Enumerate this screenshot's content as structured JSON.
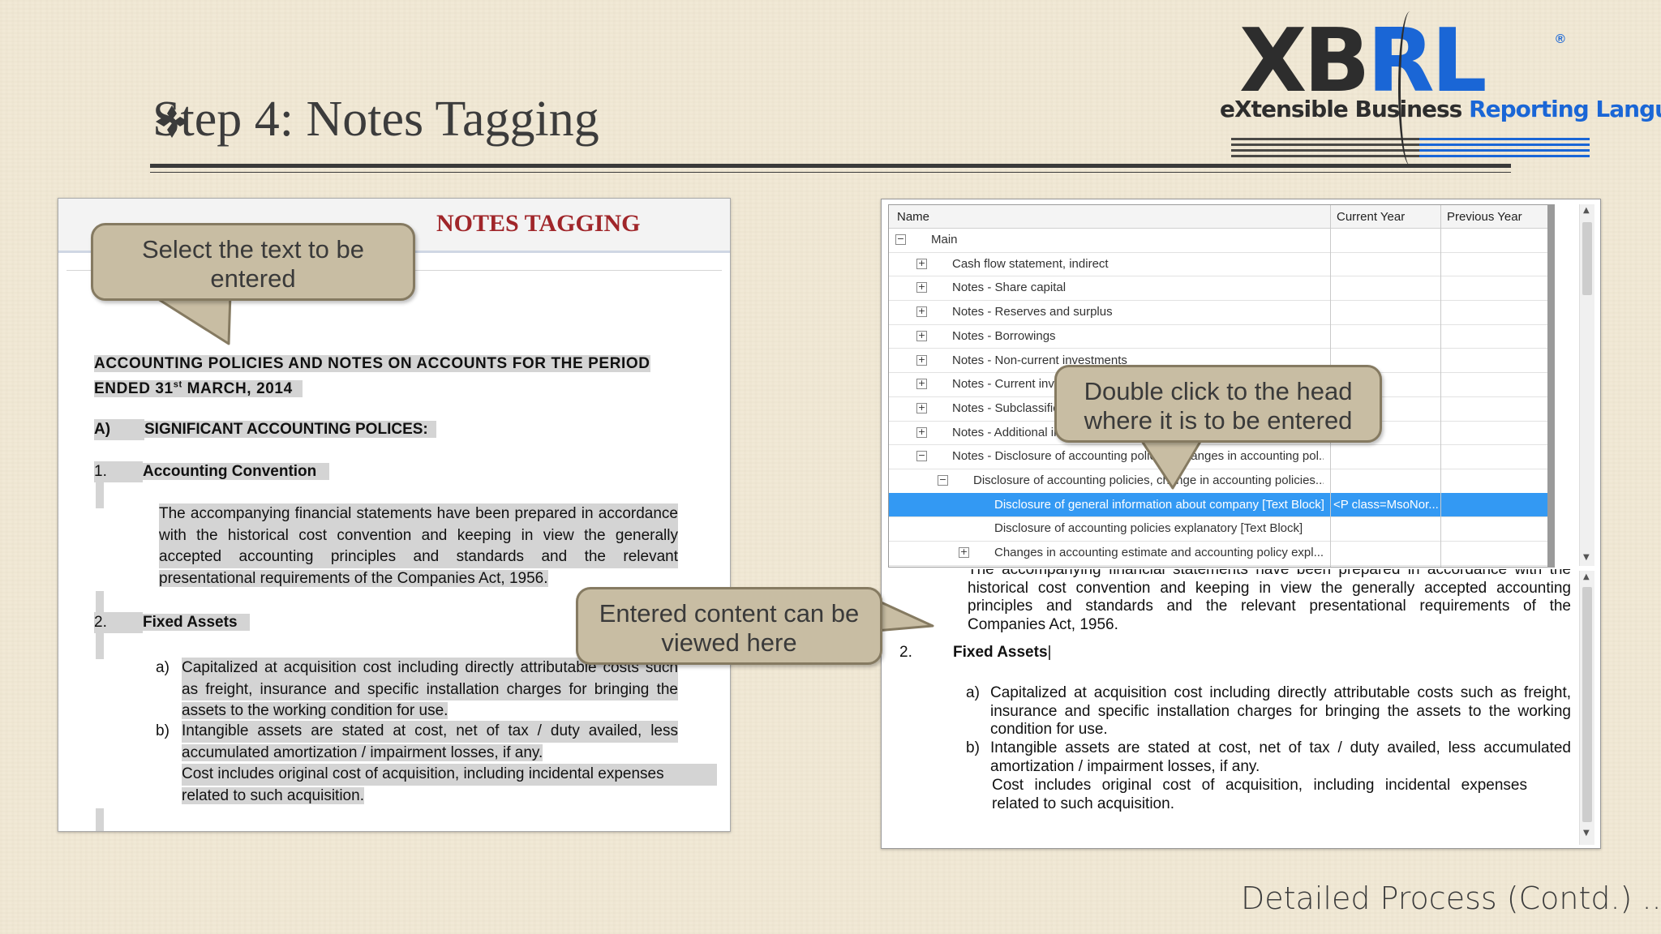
{
  "slide": {
    "title": "Step 4: Notes Tagging",
    "footer": "Detailed Process (Contd.) ..."
  },
  "logo": {
    "mark_left": "XB",
    "mark_right": "RL",
    "tagline_left": "eXtensible Business",
    "tagline_right": " Reporting Language",
    "registered": "®",
    "icon": "xbrl-logo"
  },
  "left_doc": {
    "title": "NOTES TAGGING",
    "heading_line1": "ACCOUNTING POLICIES AND NOTES ON ACCOUNTS FOR THE PERIOD",
    "heading_line2_pre": "ENDED 31",
    "heading_line2_sup": "st",
    "heading_line2_post": " MARCH, 2014",
    "section_a_num": "A)",
    "section_a_title": "SIGNIFICANT ACCOUNTING POLICES:",
    "item1_num": "1.",
    "item1_title": "Accounting Convention",
    "item1_lines": [
      "The accompanying financial statements have been prepared in accordance",
      "with the historical cost convention and keeping in view the generally",
      "accepted accounting principles and standards and the relevant",
      "presentational requirements of the Companies Act, 1956."
    ],
    "item2_num": "2.",
    "item2_title": "Fixed Assets",
    "a_label": "a)",
    "a_lines": [
      "Capitalized at acquisition cost including directly attributable costs such",
      "as freight, insurance and specific installation charges for bringing the",
      "assets to the working condition for use."
    ],
    "b_label": "b)",
    "b_lines": [
      "Intangible assets are stated at cost, net of tax / duty availed, less",
      "accumulated amortization / impairment losses, if any."
    ],
    "cost_lines": [
      "Cost includes original cost of acquisition, including incidental expenses",
      "related to such acquisition."
    ]
  },
  "tree": {
    "columns": [
      "Name",
      "Current Year",
      "Previous Year"
    ],
    "rows": [
      {
        "label": "Main",
        "expander": "−",
        "current": ""
      },
      {
        "label": "Cash flow statement, indirect",
        "expander": "+",
        "current": ""
      },
      {
        "label": "Notes - Share capital",
        "expander": "+",
        "current": ""
      },
      {
        "label": "Notes - Reserves and surplus",
        "expander": "+",
        "current": ""
      },
      {
        "label": "Notes - Borrowings",
        "expander": "+",
        "current": ""
      },
      {
        "label": "Notes - Non-current investments",
        "expander": "+",
        "current": ""
      },
      {
        "label": "Notes - Current investments",
        "expander": "+",
        "current": ""
      },
      {
        "label": "Notes - Subclassification",
        "expander": "+",
        "current": ""
      },
      {
        "label": "Notes - Additional information",
        "expander": "+",
        "current": ""
      },
      {
        "label": "Notes - Disclosure of accounting policies, changes in accounting pol...",
        "expander": "−",
        "current": ""
      },
      {
        "label": "Disclosure of accounting policies, change in accounting policies...",
        "expander": "−",
        "current": ""
      },
      {
        "label": "Disclosure of general information about company [Text Block]",
        "expander": "",
        "current": "<P class=MsoNor..."
      },
      {
        "label": "Disclosure of accounting policies explanatory [Text Block]",
        "expander": "",
        "current": ""
      },
      {
        "label": "Changes in accounting estimate and accounting policy expl...",
        "expander": "+",
        "current": ""
      }
    ]
  },
  "preview": {
    "lines_top": [
      "The accompanying financial statements have been prepared in accordance with the",
      "historical cost convention and keeping in view the generally accepted accounting",
      "principles and standards and the relevant presentational requirements of the",
      "Companies Act, 1956."
    ],
    "item2_num": "2.",
    "item2_title": "Fixed Assets",
    "a_label": "a)",
    "a_lines": [
      "Capitalized at acquisition cost including directly attributable costs such as freight,",
      "insurance and specific installation charges for bringing the assets to the working",
      "condition for use."
    ],
    "b_label": "b)",
    "b_lines": [
      "Intangible assets are stated at cost, net of tax / duty availed, less accumulated",
      "amortization / impairment losses, if any."
    ],
    "cost_lines": [
      "Cost includes original cost of acquisition, including incidental expenses",
      "related to such acquisition."
    ]
  },
  "callouts": {
    "select_line1": "Select the text to be",
    "select_line2": "entered",
    "double_line1": "Double click to the head",
    "double_line2": "where it is to be entered",
    "viewed_line1": "Entered content can be",
    "viewed_line2": "viewed here"
  },
  "colors": {
    "callout_fill": "#c8bda3",
    "callout_border": "#857a61",
    "selection": "#3399f3",
    "notes_title": "#a0262a",
    "logo_blue": "#1a66d6"
  }
}
